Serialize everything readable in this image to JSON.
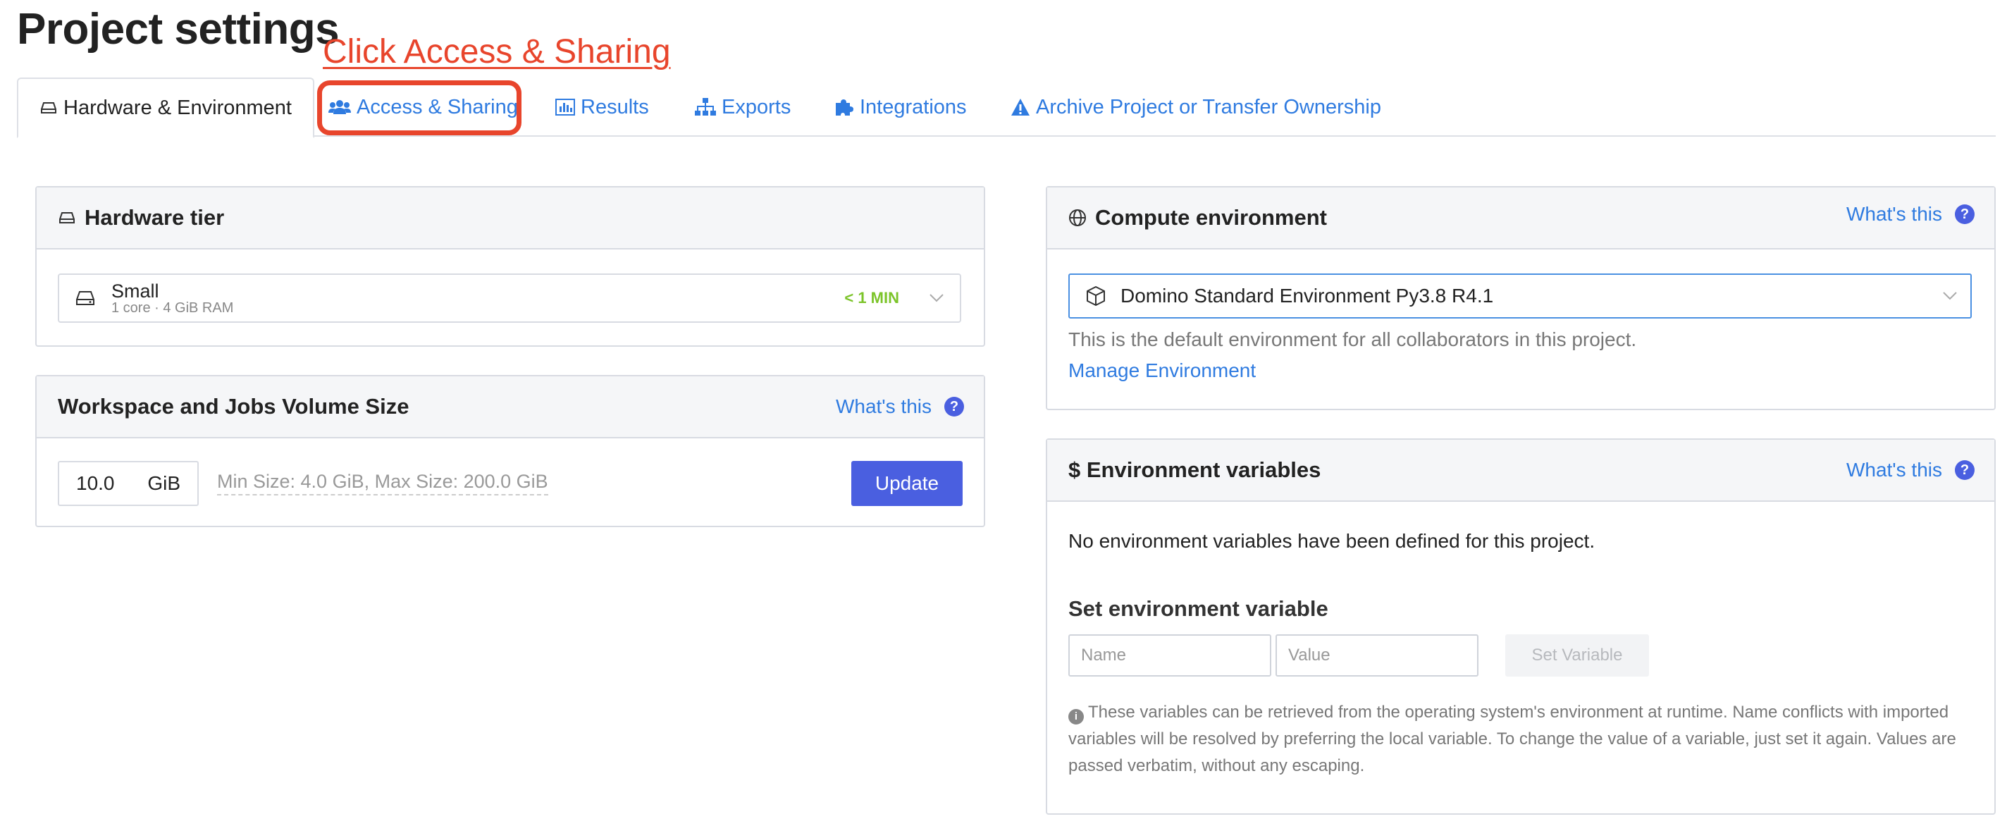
{
  "page": {
    "title": "Project settings"
  },
  "annotation": {
    "text": "Click Access & Sharing",
    "color": "#e8452c"
  },
  "tabs": [
    {
      "label": "Hardware & Environment",
      "icon": "drive-icon",
      "active": true
    },
    {
      "label": "Access & Sharing",
      "icon": "users-icon",
      "active": false
    },
    {
      "label": "Results",
      "icon": "bar-chart-icon",
      "active": false
    },
    {
      "label": "Exports",
      "icon": "sitemap-icon",
      "active": false
    },
    {
      "label": "Integrations",
      "icon": "puzzle-icon",
      "active": false
    },
    {
      "label": "Archive Project or Transfer Ownership",
      "icon": "warning-icon",
      "active": false
    }
  ],
  "hardware_tier": {
    "title": "Hardware tier",
    "selected_name": "Small",
    "selected_specs": "1 core · 4 GiB RAM",
    "startup_time": "< 1 MIN"
  },
  "volume": {
    "title": "Workspace and Jobs Volume Size",
    "whats_this": "What's this",
    "value": "10.0",
    "unit": "GiB",
    "hint": "Min Size: 4.0 GiB, Max Size: 200.0 GiB",
    "update_label": "Update"
  },
  "compute_env": {
    "title": "Compute environment",
    "whats_this": "What's this",
    "selected": "Domino Standard Environment Py3.8 R4.1",
    "description": "This is the default environment for all collaborators in this project.",
    "manage_link": "Manage Environment"
  },
  "env_vars": {
    "title": "$ Environment variables",
    "whats_this": "What's this",
    "empty_message": "No environment variables have been defined for this project.",
    "set_title": "Set environment variable",
    "name_placeholder": "Name",
    "value_placeholder": "Value",
    "set_button": "Set Variable",
    "note": "These variables can be retrieved from the operating system's environment at runtime. Name conflicts with imported variables will be resolved by preferring the local variable. To change the value of a variable, just set it again. Values are passed verbatim, without any escaping."
  },
  "colors": {
    "accent": "#4a5fe0",
    "link": "#2f7be0",
    "success": "#7cc42a",
    "annotation": "#e8452c"
  }
}
